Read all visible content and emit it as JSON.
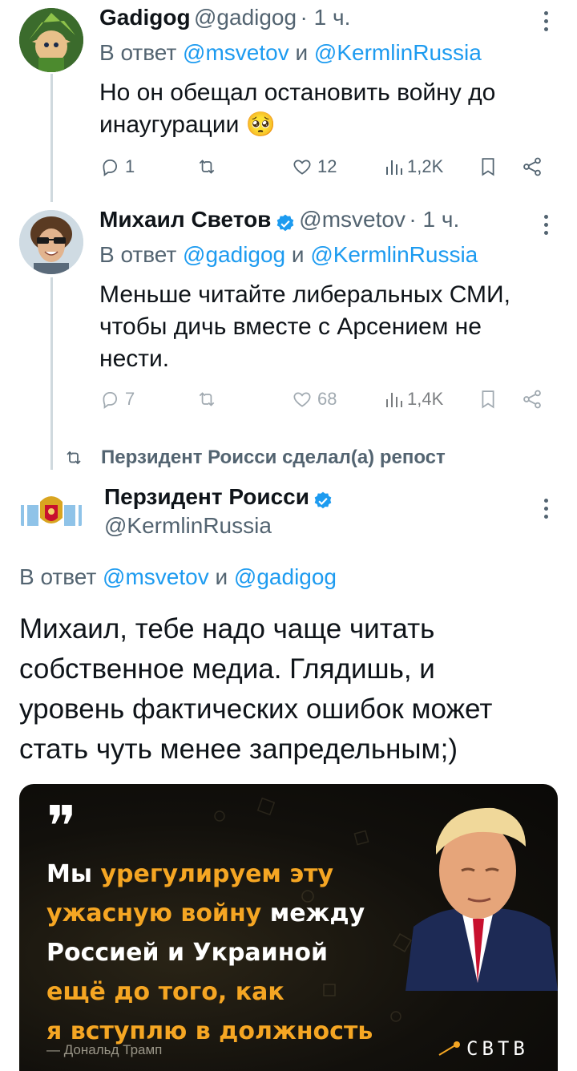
{
  "tweets": [
    {
      "name": "Gadigog",
      "handle": "@gadigog",
      "time": "· 1 ч.",
      "reply_prefix": "В ответ",
      "reply_to_1": "@msvetov",
      "reply_and": "и",
      "reply_to_2": "@KermlinRussia",
      "text": "Но он обещал остановить войну до инаугурации",
      "emoji": "🥺",
      "replies": "1",
      "retweets": "",
      "likes": "12",
      "views": "1,2K"
    },
    {
      "name": "Михаил Светов",
      "handle": "@msvetov",
      "time": "· 1 ч.",
      "reply_prefix": "В ответ",
      "reply_to_1": "@gadigog",
      "reply_and": "и",
      "reply_to_2": "@KermlinRussia",
      "text": "Меньше читайте либеральных СМИ, чтобы дичь вместе с Арсением не нести.",
      "replies": "7",
      "retweets": "",
      "likes": "68",
      "views": "1,4K"
    }
  ],
  "repost_label": "Перзидент Роисси сделал(а) репост",
  "main": {
    "name": "Перзидент Роисси",
    "handle": "@KermlinRussia",
    "reply_prefix": "В ответ",
    "reply_to_1": "@msvetov",
    "reply_and": "и",
    "reply_to_2": "@gadigog",
    "text": "Михаил, тебе надо чаще читать собственное медиа. Глядишь, и уровень фактических ошибок может стать чуть менее запредельным;)"
  },
  "media": {
    "quote_mark": "❞",
    "line1_white": "Мы",
    "line1_orange": "урегулируем эту",
    "line2_orange": "ужасную войну",
    "line2_white": "между",
    "line3_white": "Россией и Украиной",
    "line4_orange": "ещё до того, как",
    "line5_orange": "я вступлю в должность",
    "attribution": "— Дональд Трамп",
    "brand": "СВТВ"
  },
  "colors": {
    "accent": "#1d9bf0",
    "muted": "#536471",
    "quote_orange": "#f5a623"
  }
}
